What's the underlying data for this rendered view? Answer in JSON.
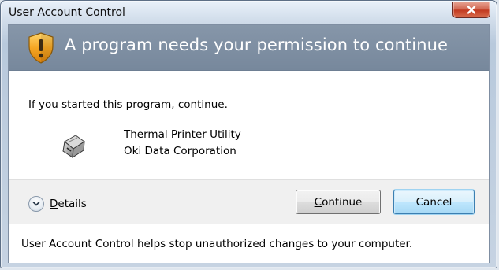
{
  "window": {
    "title": "User Account Control"
  },
  "banner": {
    "heading": "A program needs your permission to continue",
    "icon": "shield-warning-icon"
  },
  "message": {
    "intro": "If you started this program, continue.",
    "program_icon": "printer-icon",
    "program_name": "Thermal Printer Utility",
    "publisher": "Oki Data Corporation"
  },
  "actions": {
    "details_label_first": "D",
    "details_label_rest": "etails",
    "continue_label_first": "C",
    "continue_label_rest": "ontinue",
    "cancel_label": "Cancel"
  },
  "footer": {
    "text": "User Account Control helps stop unauthorized changes to your computer."
  },
  "colors": {
    "banner": "#7d8ea2",
    "close_button": "#c8452b",
    "shield": "#f2a81d",
    "default_button_border": "#3c7fb1"
  }
}
